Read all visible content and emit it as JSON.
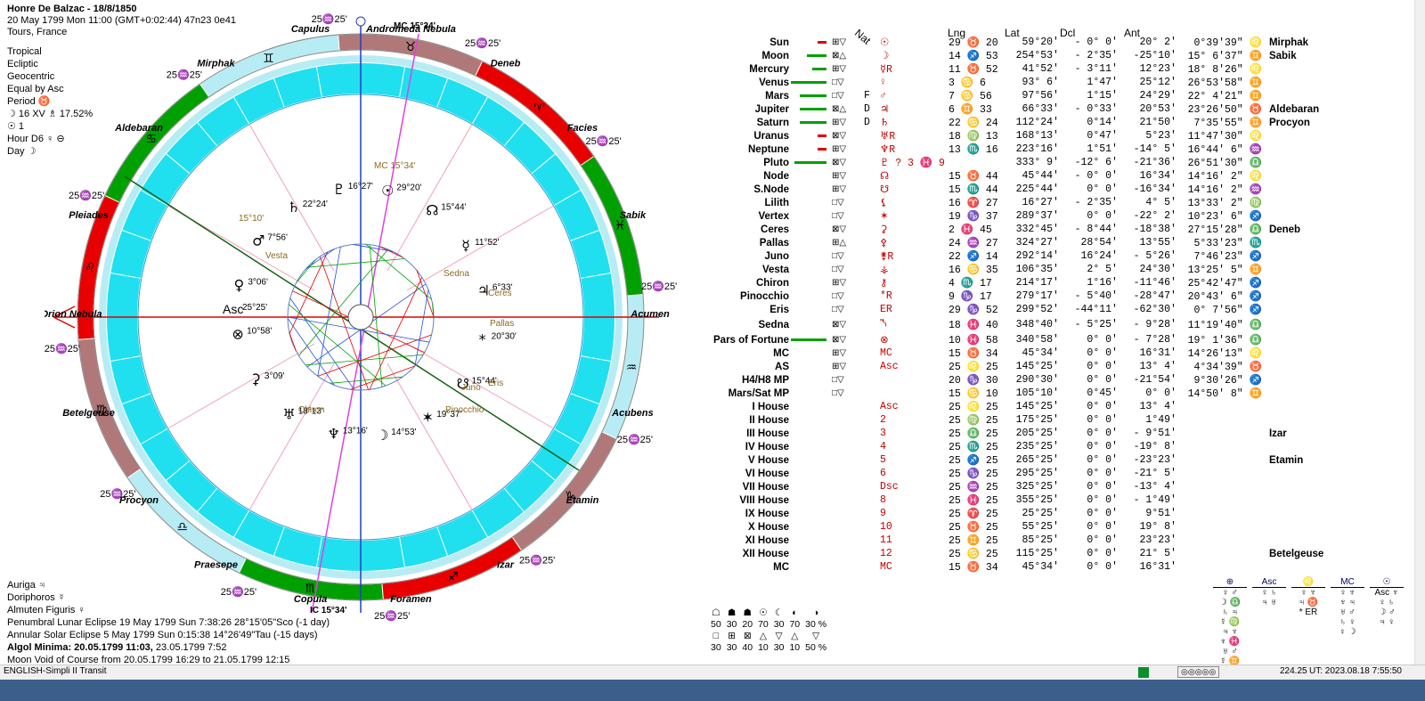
{
  "header": {
    "name": "Honre De Balzac - 18/8/1850",
    "line2": "20 May 1799  Mon   11:00 (GMT+0:02:44) 47n23  0e41",
    "place": "Tours, France"
  },
  "settings": [
    "Tropical",
    "Ecliptic",
    "Geocentric",
    "Equal by Asc",
    "Period ♉",
    "☽  16 XV  ♗ 17.52%",
    "☉  1",
    "Hour D6 ♀ ⊖",
    "Day ☽"
  ],
  "bottom_info": [
    {
      "text": "Auriga  ♃",
      "bold": false
    },
    {
      "text": "Doriphoros  ☿",
      "bold": false
    },
    {
      "text": "Almuten Figuris  ♀",
      "bold": false
    },
    {
      "text": "Penumbral Lunar Eclipse 19 May 1799 Sun  7:38:26 28°15'05\"Sco (-1 day)",
      "bold": false
    },
    {
      "text": "Annular Solar Eclipse 5 May 1799 Sun  0:15:38 14°26'49\"Tau (-15 days)",
      "bold": false
    },
    {
      "text": "Algol Minima: 20.05.1799 11:03,",
      "bold": true,
      "extra": "  23.05.1799  7:52"
    },
    {
      "text": "Moon Void of Course from 20.05.1799 16:29 to 21.05.1799 12:15",
      "bold": false
    }
  ],
  "columns": {
    "nat": "Nat",
    "lng": "Lng",
    "lat": "Lat",
    "dcl": "Dcl",
    "ant": "Ant"
  },
  "table_rows": [
    {
      "name": "Sun",
      "bar_color": "#e00000",
      "bar_len": 10,
      "asp": "⊞▽",
      "flag": "",
      "glyph": "☉",
      "lng_sign": "29 ♉ 20",
      "lng": "59°20'",
      "lat": "- 0° 0'",
      "dcl": "20° 2'",
      "ant": "0°39'39\" ♌",
      "star": "Mirphak"
    },
    {
      "name": "Moon",
      "bar_color": "#00a000",
      "bar_len": 22,
      "asp": "⊠△",
      "flag": "",
      "glyph": "☽",
      "lng_sign": "14 ♐ 53",
      "lng": "254°53'",
      "lat": "- 2°35'",
      "dcl": "-25°10'",
      "ant": "15° 6'37\" ♊",
      "star": "Sabik"
    },
    {
      "name": "Mercury",
      "bar_color": "#00a000",
      "bar_len": 16,
      "asp": "⊞▽",
      "flag": "",
      "glyph": "☿R",
      "lng_sign": "11 ♉ 52",
      "lng": "41°52'",
      "lat": "- 3°11'",
      "dcl": "12°23'",
      "ant": "18° 8'26\" ♌",
      "star": ""
    },
    {
      "name": "Venus",
      "bar_color": "#00a000",
      "bar_len": 40,
      "asp": "□▽",
      "flag": "",
      "glyph": "♀",
      "lng_sign": "3 ♋ 6",
      "lng": "93° 6'",
      "lat": "1°47'",
      "dcl": "25°12'",
      "ant": "26°53'58\" ♊",
      "star": ""
    },
    {
      "name": "Mars",
      "bar_color": "#00a000",
      "bar_len": 30,
      "asp": "□▽",
      "flag": "F",
      "glyph": "♂",
      "lng_sign": "7 ♋ 56",
      "lng": "97°56'",
      "lat": "1°15'",
      "dcl": "24°29'",
      "ant": "22° 4'21\" ♊",
      "star": ""
    },
    {
      "name": "Jupiter",
      "bar_color": "#00a000",
      "bar_len": 30,
      "asp": "⊠△",
      "flag": "D",
      "glyph": "♃",
      "lng_sign": "6 ♊ 33",
      "lng": "66°33'",
      "lat": "- 0°33'",
      "dcl": "20°53'",
      "ant": "23°26'50\" ♉",
      "star": "Aldebaran"
    },
    {
      "name": "Saturn",
      "bar_color": "#00a000",
      "bar_len": 30,
      "asp": "⊞▽",
      "flag": "D",
      "glyph": "♄",
      "lng_sign": "22 ♋ 24",
      "lng": "112°24'",
      "lat": "0°14'",
      "dcl": "21°50'",
      "ant": "7°35'55\" ♊",
      "star": "Procyon"
    },
    {
      "name": "Uranus",
      "bar_color": "#e00000",
      "bar_len": 10,
      "asp": "⊠▽",
      "flag": "",
      "glyph": "♅R",
      "lng_sign": "18 ♍ 13",
      "lng": "168°13'",
      "lat": "0°47'",
      "dcl": "5°23'",
      "ant": "11°47'30\" ♌",
      "star": ""
    },
    {
      "name": "Neptune",
      "bar_color": "#e00000",
      "bar_len": 10,
      "asp": "⊞▽",
      "flag": "",
      "glyph": "♆R",
      "lng_sign": "13 ♏ 16",
      "lng": "223°16'",
      "lat": "1°51'",
      "dcl": "-14° 5'",
      "ant": "16°44' 6\" ♒",
      "star": ""
    },
    {
      "name": "Pluto",
      "bar_color": "#00a000",
      "bar_len": 36,
      "asp": "⊠▽",
      "flag": "",
      "glyph": "♇ ? 3 ♓ 9",
      "lng_sign": "",
      "lng": "333° 9'",
      "lat": "-12° 6'",
      "dcl": "-21°36'",
      "ant": "26°51'30\" ♎",
      "star": ""
    },
    {
      "name": "Node",
      "bar_color": "",
      "bar_len": 0,
      "asp": "⊞▽",
      "flag": "",
      "glyph": "☊",
      "lng_sign": "15 ♉ 44",
      "lng": "45°44'",
      "lat": "- 0° 0'",
      "dcl": "16°34'",
      "ant": "14°16' 2\" ♌",
      "star": ""
    },
    {
      "name": "S.Node",
      "bar_color": "",
      "bar_len": 0,
      "asp": "⊞▽",
      "flag": "",
      "glyph": "☋",
      "lng_sign": "15 ♏ 44",
      "lng": "225°44'",
      "lat": "0° 0'",
      "dcl": "-16°34'",
      "ant": "14°16' 2\" ♒",
      "star": ""
    },
    {
      "name": "Lilith",
      "bar_color": "",
      "bar_len": 0,
      "asp": "□▽",
      "flag": "",
      "glyph": "⚸",
      "lng_sign": "16 ♈ 27",
      "lng": "16°27'",
      "lat": "- 2°35'",
      "dcl": "4° 5'",
      "ant": "13°33' 2\" ♍",
      "star": ""
    },
    {
      "name": "Vertex",
      "bar_color": "",
      "bar_len": 0,
      "asp": "□▽",
      "flag": "",
      "glyph": "✶",
      "lng_sign": "19 ♑ 37",
      "lng": "289°37'",
      "lat": "0° 0'",
      "dcl": "-22° 2'",
      "ant": "10°23' 6\" ♐",
      "star": ""
    },
    {
      "name": "Ceres",
      "bar_color": "",
      "bar_len": 0,
      "asp": "⊠▽",
      "flag": "",
      "glyph": "⚳",
      "lng_sign": "2 ♓ 45",
      "lng": "332°45'",
      "lat": "- 8°44'",
      "dcl": "-18°38'",
      "ant": "27°15'28\" ♎",
      "star": "Deneb"
    },
    {
      "name": "Pallas",
      "bar_color": "",
      "bar_len": 0,
      "asp": "⊞△",
      "flag": "",
      "glyph": "⚴",
      "lng_sign": "24 ♒ 27",
      "lng": "324°27'",
      "lat": "28°54'",
      "dcl": "13°55'",
      "ant": "5°33'23\" ♏",
      "star": ""
    },
    {
      "name": "Juno",
      "bar_color": "",
      "bar_len": 0,
      "asp": "□▽",
      "flag": "",
      "glyph": "⚵R",
      "lng_sign": "22 ♐ 14",
      "lng": "292°14'",
      "lat": "16°24'",
      "dcl": "- 5°26'",
      "ant": "7°46'23\" ♐",
      "star": ""
    },
    {
      "name": "Vesta",
      "bar_color": "",
      "bar_len": 0,
      "asp": "□▽",
      "flag": "",
      "glyph": "⚶",
      "lng_sign": "16 ♋ 35",
      "lng": "106°35'",
      "lat": "2° 5'",
      "dcl": "24°30'",
      "ant": "13°25' 5\" ♊",
      "star": ""
    },
    {
      "name": "Chiron",
      "bar_color": "",
      "bar_len": 0,
      "asp": "⊞▽",
      "flag": "",
      "glyph": "⚷",
      "lng_sign": "4 ♏ 17",
      "lng": "214°17'",
      "lat": "1°16'",
      "dcl": "-11°46'",
      "ant": "25°42'47\" ♐",
      "star": ""
    },
    {
      "name": "Pinocchio",
      "bar_color": "",
      "bar_len": 0,
      "asp": "□▽",
      "flag": "",
      "glyph": "*R",
      "lng_sign": "9 ♑ 17",
      "lng": "279°17'",
      "lat": "- 5°40'",
      "dcl": "-28°47'",
      "ant": "20°43' 6\" ♐",
      "star": ""
    },
    {
      "name": "Eris",
      "bar_color": "",
      "bar_len": 0,
      "asp": "□▽",
      "flag": "",
      "glyph": "ER",
      "lng_sign": "29 ♑ 52",
      "lng": "299°52'",
      "lat": "-44°11'",
      "dcl": "-62°30'",
      "ant": "0° 7'56\" ♐",
      "star": ""
    },
    {
      "name": "Sedna",
      "bar_color": "",
      "bar_len": 0,
      "asp": "⊠▽",
      "flag": "",
      "glyph": "⯲",
      "lng_sign": "18 ♓ 40",
      "lng": "348°40'",
      "lat": "- 5°25'",
      "dcl": "- 9°28'",
      "ant": "11°19'40\" ♎",
      "star": ""
    },
    {
      "name": "Pars of Fortune",
      "bar_color": "#00a000",
      "bar_len": 40,
      "asp": "⊠▽",
      "flag": "",
      "glyph": "⊗",
      "lng_sign": "10 ♓ 58",
      "lng": "340°58'",
      "lat": "0° 0'",
      "dcl": "- 7°28'",
      "ant": "19° 1'36\" ♎",
      "star": ""
    },
    {
      "name": "MC",
      "bar_color": "",
      "bar_len": 0,
      "asp": "⊞▽",
      "flag": "",
      "glyph": "MC",
      "lng_sign": "15 ♉ 34",
      "lng": "45°34'",
      "lat": "0° 0'",
      "dcl": "16°31'",
      "ant": "14°26'13\" ♌",
      "star": ""
    },
    {
      "name": "AS",
      "bar_color": "",
      "bar_len": 0,
      "asp": "⊞▽",
      "flag": "",
      "glyph": "Asc",
      "lng_sign": "25 ♌ 25",
      "lng": "145°25'",
      "lat": "0° 0'",
      "dcl": "13° 4'",
      "ant": "4°34'39\" ♉",
      "star": ""
    },
    {
      "name": "H4/H8 MP",
      "bar_color": "",
      "bar_len": 0,
      "asp": "□▽",
      "flag": "",
      "glyph": "",
      "lng_sign": "20 ♑ 30",
      "lng": "290°30'",
      "lat": "0° 0'",
      "dcl": "-21°54'",
      "ant": "9°30'26\" ♐",
      "star": ""
    },
    {
      "name": "Mars/Sat MP",
      "bar_color": "",
      "bar_len": 0,
      "asp": "□▽",
      "flag": "",
      "glyph": "",
      "lng_sign": "15 ♋ 10",
      "lng": "105°10'",
      "lat": "0°45'",
      "dcl": "0° 0'",
      "ant": "14°50' 8\" ♊",
      "star": ""
    },
    {
      "name": "I House",
      "bar_color": "",
      "bar_len": 0,
      "asp": "",
      "flag": "",
      "glyph": "Asc",
      "lng_sign": "25 ♌ 25",
      "lng": "145°25'",
      "lat": "0° 0'",
      "dcl": "13° 4'",
      "ant": "",
      "star": ""
    },
    {
      "name": "II House",
      "bar_color": "",
      "bar_len": 0,
      "asp": "",
      "flag": "",
      "glyph": "2",
      "lng_sign": "25 ♍ 25",
      "lng": "175°25'",
      "lat": "0° 0'",
      "dcl": "1°49'",
      "ant": "",
      "star": ""
    },
    {
      "name": "III House",
      "bar_color": "",
      "bar_len": 0,
      "asp": "",
      "flag": "",
      "glyph": "3",
      "lng_sign": "25 ♎ 25",
      "lng": "205°25'",
      "lat": "0° 0'",
      "dcl": "- 9°51'",
      "ant": "",
      "star": "Izar"
    },
    {
      "name": "IV House",
      "bar_color": "",
      "bar_len": 0,
      "asp": "",
      "flag": "",
      "glyph": "4",
      "lng_sign": "25 ♏ 25",
      "lng": "235°25'",
      "lat": "0° 0'",
      "dcl": "-19° 8'",
      "ant": "",
      "star": ""
    },
    {
      "name": "V House",
      "bar_color": "",
      "bar_len": 0,
      "asp": "",
      "flag": "",
      "glyph": "5",
      "lng_sign": "25 ♐ 25",
      "lng": "265°25'",
      "lat": "0° 0'",
      "dcl": "-23°23'",
      "ant": "",
      "star": "Etamin"
    },
    {
      "name": "VI House",
      "bar_color": "",
      "bar_len": 0,
      "asp": "",
      "flag": "",
      "glyph": "6",
      "lng_sign": "25 ♑ 25",
      "lng": "295°25'",
      "lat": "0° 0'",
      "dcl": "-21° 5'",
      "ant": "",
      "star": ""
    },
    {
      "name": "VII House",
      "bar_color": "",
      "bar_len": 0,
      "asp": "",
      "flag": "",
      "glyph": "Dsc",
      "lng_sign": "25 ♒ 25",
      "lng": "325°25'",
      "lat": "0° 0'",
      "dcl": "-13° 4'",
      "ant": "",
      "star": ""
    },
    {
      "name": "VIII House",
      "bar_color": "",
      "bar_len": 0,
      "asp": "",
      "flag": "",
      "glyph": "8",
      "lng_sign": "25 ♓ 25",
      "lng": "355°25'",
      "lat": "0° 0'",
      "dcl": "- 1°49'",
      "ant": "",
      "star": ""
    },
    {
      "name": "IX House",
      "bar_color": "",
      "bar_len": 0,
      "asp": "",
      "flag": "",
      "glyph": "9",
      "lng_sign": "25 ♈ 25",
      "lng": "25°25'",
      "lat": "0° 0'",
      "dcl": "9°51'",
      "ant": "",
      "star": ""
    },
    {
      "name": "X House",
      "bar_color": "",
      "bar_len": 0,
      "asp": "",
      "flag": "",
      "glyph": "10",
      "lng_sign": "25 ♉ 25",
      "lng": "55°25'",
      "lat": "0° 0'",
      "dcl": "19° 8'",
      "ant": "",
      "star": ""
    },
    {
      "name": "XI House",
      "bar_color": "",
      "bar_len": 0,
      "asp": "",
      "flag": "",
      "glyph": "11",
      "lng_sign": "25 ♊ 25",
      "lng": "85°25'",
      "lat": "0° 0'",
      "dcl": "23°23'",
      "ant": "",
      "star": ""
    },
    {
      "name": "XII House",
      "bar_color": "",
      "bar_len": 0,
      "asp": "",
      "flag": "",
      "glyph": "12",
      "lng_sign": "25 ♋ 25",
      "lng": "115°25'",
      "lat": "0° 0'",
      "dcl": "21° 5'",
      "ant": "",
      "star": "Betelgeuse"
    },
    {
      "name": "MC",
      "bar_color": "",
      "bar_len": 0,
      "asp": "",
      "flag": "",
      "glyph": "MC",
      "lng_sign": "15 ♉ 34",
      "lng": "45°34'",
      "lat": "0° 0'",
      "dcl": "16°31'",
      "ant": "",
      "star": ""
    }
  ],
  "wheel": {
    "cusp_labels": [
      "25♒25'",
      "25♒25'",
      "25♒25'",
      "25♒25'",
      "25♒25'",
      "25♒25'",
      "25♒25'",
      "25♒25'",
      "25♒25'",
      "25♒25'",
      "25♒25'",
      "25♒25'"
    ],
    "asc_label": "Asc",
    "asc_deg": "25°25'",
    "mc_label": "MC 15°34'",
    "ic_label": "IC 15°34'",
    "vertex_deg": "19°37'",
    "stars": [
      "Capulus",
      "Mirphak",
      "Aldebaran",
      "Pleiades",
      "Orion Nebula",
      "Betelgeuse",
      "Procyon",
      "Praesepe",
      "Copula",
      "Foramen",
      "Izar",
      "Etamin",
      "Acubens",
      "Acumen",
      "Sabik",
      "Facies",
      "Deneb",
      "Andromeda Nebula"
    ],
    "planet_labels": [
      {
        "sym": "♃",
        "deg": "6°33'"
      },
      {
        "sym": "☿",
        "deg": "11°52'"
      },
      {
        "sym": "☊",
        "deg": "15°44'"
      },
      {
        "sym": "☉",
        "deg": "29°20'"
      },
      {
        "sym": "♇",
        "deg": "16°27'"
      },
      {
        "sym": "♄",
        "deg": "22°24'"
      },
      {
        "sym": "♂",
        "deg": "7°56'"
      },
      {
        "sym": "♀",
        "deg": "3°06'"
      },
      {
        "sym": "⊗",
        "deg": "10°58'"
      },
      {
        "sym": "⚳",
        "deg": "3°09'"
      },
      {
        "sym": "♅",
        "deg": "18°13'"
      },
      {
        "sym": "♆",
        "deg": "13°16'"
      },
      {
        "sym": "☽",
        "deg": "14°53'"
      },
      {
        "sym": "✶",
        "deg": "19°37'"
      },
      {
        "sym": "☋",
        "deg": "15°44'"
      },
      {
        "sym": "*",
        "deg": "20°30'"
      }
    ],
    "small_labels": [
      "Vesta",
      "Sedna",
      "Ceres",
      "Pallas",
      "Juno",
      "Eris",
      "Chiron",
      "Pinocchio",
      "15°10'",
      "MC 15°34'"
    ]
  },
  "modes": {
    "row1_syms": [
      "☖",
      "☗",
      "☗",
      "☉",
      "☾",
      "◐",
      "◑"
    ],
    "row1_vals": [
      "50",
      "30",
      "20",
      "70",
      "30",
      "70",
      "30 %"
    ],
    "row2_syms": [
      "□",
      "⊞",
      "⊠",
      "△",
      "▽",
      "△",
      "▽"
    ],
    "row2_vals": [
      "30",
      "30",
      "40",
      "10",
      "30",
      "10",
      "50 %"
    ]
  },
  "rulers": [
    {
      "head": "⊕",
      "items": [
        "♀ ♂",
        "☽ ♎",
        "♄ ♃",
        "☿ ♍",
        "♃ ♆",
        "♆ ♓",
        "♅ ♂",
        "☿ ♊"
      ]
    },
    {
      "head": "Asc",
      "items": [
        "♀ ♄",
        "♃ ♅"
      ]
    },
    {
      "head": "♌",
      "items": [
        "♀ ♆",
        "♃ ♉",
        "* ER"
      ]
    },
    {
      "head": "MC",
      "items": [
        "♀ ♆",
        "♆ ♃",
        "♅ ♂",
        "♄ ♀",
        "♀ ☽"
      ]
    },
    {
      "head": "☉",
      "items": [
        "Asc ♆",
        "♀ ♄",
        "☽ ♂",
        "♃ ♀"
      ]
    }
  ],
  "statusbar": {
    "left": "ENGLISH-Simpli II Transit",
    "value": "224.25",
    "ut": "UT: 2023.08.18  7:55:50"
  },
  "colors": {
    "fire": "#e80000",
    "earth": "#b07878",
    "air": "#b8ecf4",
    "water": "#00a000",
    "inner": "#20e0f0"
  }
}
